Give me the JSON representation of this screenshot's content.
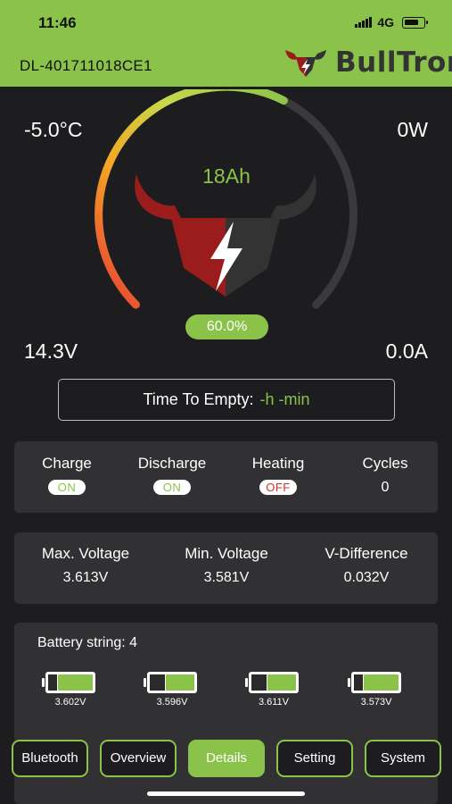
{
  "status_bar": {
    "time": "11:46",
    "network": "4G"
  },
  "header": {
    "device_id": "DL-401711018CE1",
    "brand": "BullTron"
  },
  "gauge": {
    "temperature": "-5.0°C",
    "power": "0W",
    "voltage": "14.3V",
    "current": "0.0A",
    "capacity": "18Ah",
    "soc_label": "60.0%",
    "soc": 0.6
  },
  "time_to_empty": {
    "label": "Time To Empty:",
    "value": "-h -min"
  },
  "status_panel": {
    "charge": {
      "label": "Charge",
      "state": "ON"
    },
    "discharge": {
      "label": "Discharge",
      "state": "ON"
    },
    "heating": {
      "label": "Heating",
      "state": "OFF"
    },
    "cycles": {
      "label": "Cycles",
      "value": "0"
    }
  },
  "voltage_panel": {
    "max": {
      "label": "Max. Voltage",
      "value": "3.613V"
    },
    "min": {
      "label": "Min. Voltage",
      "value": "3.581V"
    },
    "diff": {
      "label": "V-Difference",
      "value": "0.032V"
    }
  },
  "battery_string": {
    "label": "Battery string: 4",
    "cells": [
      {
        "voltage": "3.602V",
        "level": 0.8
      },
      {
        "voltage": "3.596V",
        "level": 0.65
      },
      {
        "voltage": "3.611V",
        "level": 0.65
      },
      {
        "voltage": "3.573V",
        "level": 0.8
      }
    ]
  },
  "nav": {
    "bluetooth": "Bluetooth",
    "overview": "Overview",
    "details": "Details",
    "setting": "Setting",
    "system": "System",
    "active": "Details"
  },
  "colors": {
    "accent": "#8bc34a",
    "background": "#1d1d1f",
    "panel": "#313133",
    "off": "#d32f2f"
  }
}
